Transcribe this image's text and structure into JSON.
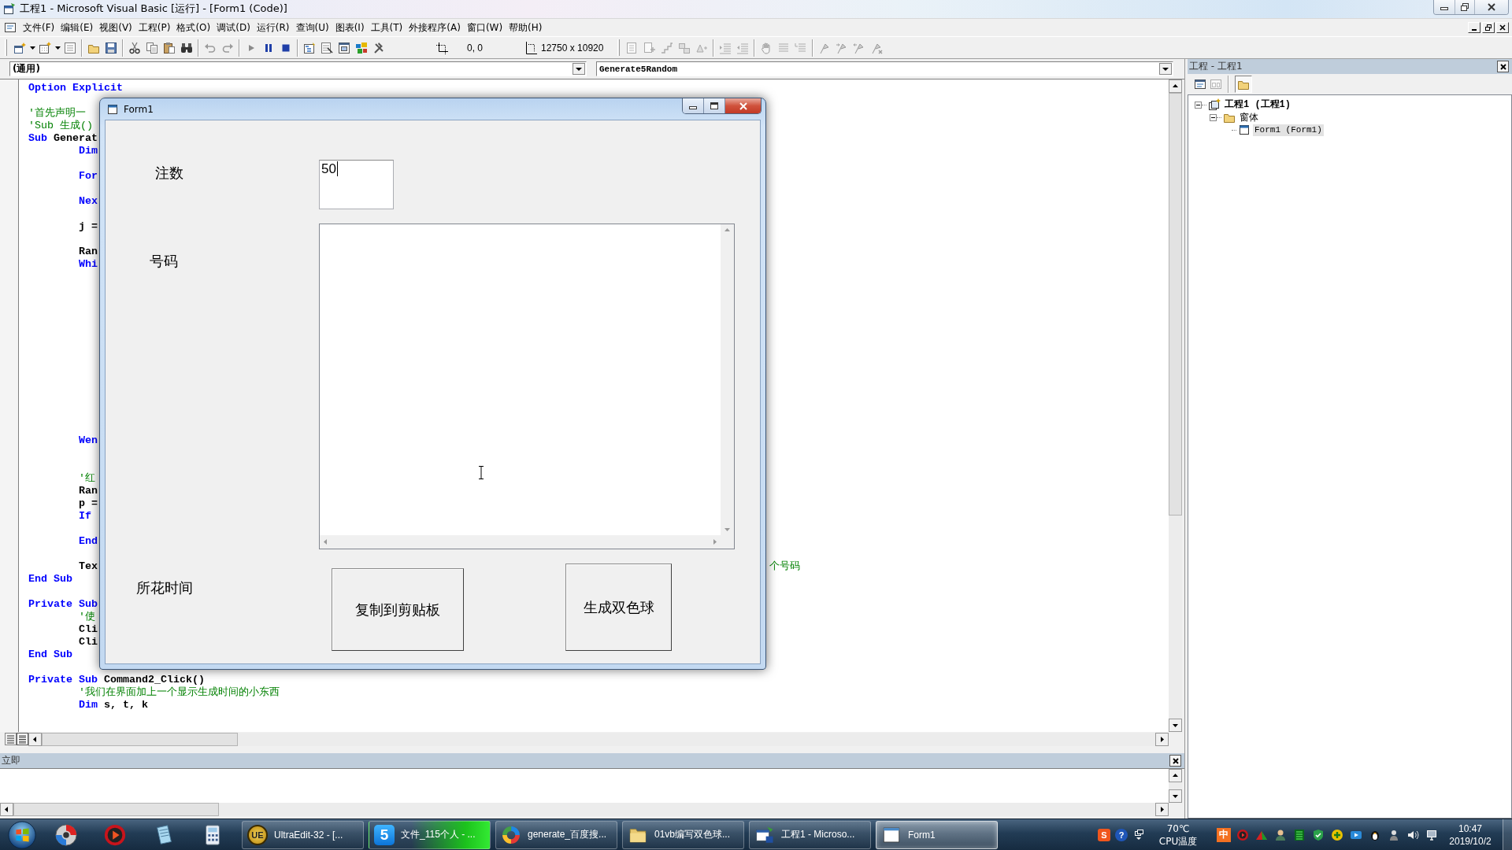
{
  "window": {
    "title": "工程1 - Microsoft Visual Basic [运行] - [Form1 (Code)]"
  },
  "menu": [
    "文件(F)",
    "编辑(E)",
    "视图(V)",
    "工程(P)",
    "格式(O)",
    "调试(D)",
    "运行(R)",
    "查询(U)",
    "图表(I)",
    "工具(T)",
    "外接程序(A)",
    "窗口(W)",
    "帮助(H)"
  ],
  "toolbar": {
    "position": "0, 0",
    "size": "12750 x 10920"
  },
  "code_window": {
    "object": "(通用)",
    "procedure": "Generate5Random",
    "lines": [
      {
        "kind": "code",
        "segments": [
          {
            "kind": "keyword",
            "text": "Option Explicit"
          }
        ]
      },
      {
        "kind": "blank"
      },
      {
        "kind": "code",
        "segments": [
          {
            "kind": "comment",
            "text": "'首先声明一"
          }
        ]
      },
      {
        "kind": "code",
        "segments": [
          {
            "kind": "comment",
            "text": "'Sub 生成()"
          }
        ]
      },
      {
        "kind": "code",
        "segments": [
          {
            "kind": "keyword",
            "text": "Sub"
          },
          {
            "kind": "plain",
            "text": "Generat"
          }
        ],
        "children": [
          {
            "kind": "code",
            "segments": [
              {
                "kind": "keyword",
                "text": "Dim"
              }
            ]
          },
          {
            "kind": "blank"
          },
          {
            "kind": "code",
            "segments": [
              {
                "kind": "keyword",
                "text": "For"
              }
            ]
          },
          {
            "kind": "blank"
          },
          {
            "kind": "code",
            "segments": [
              {
                "kind": "keyword",
                "text": "Nex"
              }
            ]
          },
          {
            "kind": "blank"
          },
          {
            "kind": "code",
            "segments": [
              {
                "kind": "plain",
                "text": "j ="
              }
            ]
          },
          {
            "kind": "blank"
          },
          {
            "kind": "code",
            "segments": [
              {
                "kind": "plain",
                "text": "Ran"
              }
            ]
          },
          {
            "kind": "code",
            "segments": [
              {
                "kind": "keyword",
                "text": "Whi"
              }
            ]
          },
          {
            "kind": "blank"
          },
          {
            "kind": "blank"
          },
          {
            "kind": "blank"
          },
          {
            "kind": "blank"
          },
          {
            "kind": "blank"
          },
          {
            "kind": "blank"
          },
          {
            "kind": "blank"
          },
          {
            "kind": "blank"
          },
          {
            "kind": "blank"
          },
          {
            "kind": "blank"
          },
          {
            "kind": "blank"
          },
          {
            "kind": "blank"
          },
          {
            "kind": "blank"
          },
          {
            "kind": "code",
            "segments": [
              {
                "kind": "keyword",
                "text": "Wen"
              }
            ]
          },
          {
            "kind": "blank"
          },
          {
            "kind": "blank"
          },
          {
            "kind": "code",
            "segments": [
              {
                "kind": "comment",
                "text": "'红"
              }
            ]
          },
          {
            "kind": "code",
            "segments": [
              {
                "kind": "plain",
                "text": "Ran"
              }
            ]
          },
          {
            "kind": "code",
            "segments": [
              {
                "kind": "plain",
                "text": "p ="
              }
            ]
          },
          {
            "kind": "code",
            "segments": [
              {
                "kind": "keyword",
                "text": "If"
              }
            ]
          },
          {
            "kind": "blank"
          },
          {
            "kind": "code",
            "segments": [
              {
                "kind": "keyword",
                "text": "End"
              }
            ]
          },
          {
            "kind": "blank"
          },
          {
            "kind": "code",
            "segments": [
              {
                "kind": "plain",
                "text": "Tex"
              }
            ],
            "tail": {
              "kind": "comment",
              "text": "个号码"
            }
          }
        ]
      },
      {
        "kind": "code",
        "segments": [
          {
            "kind": "keyword",
            "text": "End Sub"
          }
        ]
      },
      {
        "kind": "blank"
      },
      {
        "kind": "code",
        "segments": [
          {
            "kind": "keyword",
            "text": "Private Sub"
          }
        ],
        "children": [
          {
            "kind": "code",
            "segments": [
              {
                "kind": "comment",
                "text": "'使"
              }
            ]
          },
          {
            "kind": "code",
            "segments": [
              {
                "kind": "plain",
                "text": "Cli"
              }
            ]
          },
          {
            "kind": "code",
            "segments": [
              {
                "kind": "plain",
                "text": "Cli"
              }
            ]
          }
        ]
      },
      {
        "kind": "code",
        "segments": [
          {
            "kind": "keyword",
            "text": "End Sub"
          }
        ]
      },
      {
        "kind": "blank"
      },
      {
        "kind": "code",
        "segments": [
          {
            "kind": "keyword",
            "text": "Private Sub"
          },
          {
            "kind": "plain",
            "text": "Command2_Click()"
          }
        ],
        "children": [
          {
            "kind": "code",
            "segments": [
              {
                "kind": "comment",
                "text": "'我们在界面加上一个显示生成时间的小东西"
              }
            ]
          },
          {
            "kind": "code",
            "segments": [
              {
                "kind": "keyword",
                "text": "Dim"
              },
              {
                "kind": "plain",
                "text": "s, t, k"
              }
            ]
          }
        ]
      }
    ]
  },
  "form_window": {
    "title": "Form1",
    "count_label": "注数",
    "count_field": {
      "value": "50",
      "focused": true
    },
    "numbers_label": "号码",
    "time_label": "所花时间",
    "buttons": [
      "复制到剪贴板",
      "生成双色球"
    ]
  },
  "immediate_window": {
    "title": "立即"
  },
  "project_panel": {
    "title": "工程 - 工程1",
    "folders_on": true,
    "tree": [
      {
        "kind": "project",
        "label": "工程1 (工程1)",
        "expanded": true,
        "selected": false,
        "children": [
          {
            "kind": "folder",
            "label": "窗体",
            "expanded": true,
            "selected": false,
            "children": [
              {
                "kind": "form",
                "label": "Form1 (Form1)",
                "selected": true
              }
            ]
          }
        ]
      }
    ]
  },
  "taskbar": {
    "tasks": [
      {
        "label": "UltraEdit-32 - [...",
        "icon_text": "UE",
        "selected": false,
        "attention": false
      },
      {
        "label": "文件_115个人 - ...",
        "icon_text": "5",
        "selected": false,
        "attention": true
      },
      {
        "label": "generate_百度搜...",
        "selected": false,
        "attention": false
      },
      {
        "label": "01vb编写双色球...",
        "selected": false,
        "attention": false
      },
      {
        "label": "工程1 - Microso...",
        "selected": false,
        "attention": false
      },
      {
        "label": "Form1",
        "selected": true,
        "attention": false
      }
    ],
    "tray": {
      "badges": [
        {
          "text": "S",
          "color": "#f0561d"
        },
        {
          "text": "?",
          "color": "#1f56b8"
        }
      ],
      "cpu_temp": "70℃",
      "cpu_label": "CPU温度",
      "ime": "中",
      "time": "10:47",
      "date": "2019/10/2"
    }
  }
}
